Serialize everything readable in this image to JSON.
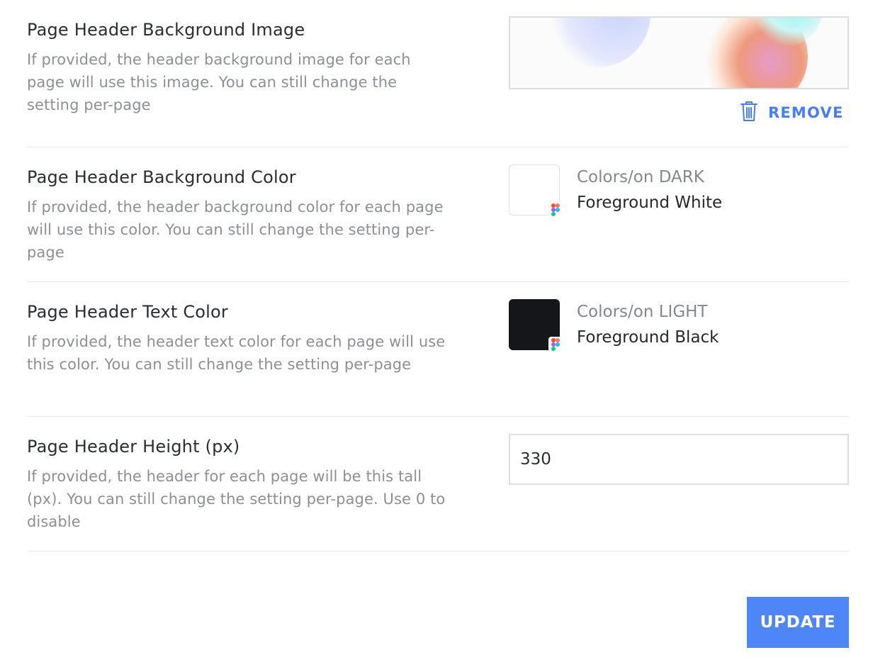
{
  "settings": {
    "background_image": {
      "title": "Page Header Background Image",
      "description": "If provided, the header background image for each page will use this image. You can still change the setting per-page",
      "remove_label": "REMOVE"
    },
    "background_color": {
      "title": "Page Header Background Color",
      "description": "If provided, the header background color for each page will use this color. You can still change the setting per-page",
      "color_group": "Colors/on DARK",
      "color_name": "Foreground White",
      "swatch_color": "#FFFFFF"
    },
    "text_color": {
      "title": "Page Header Text Color",
      "description": "If provided, the header text color for each page will use this color. You can still change the setting per-page",
      "color_group": "Colors/on LIGHT",
      "color_name": "Foreground Black",
      "swatch_color": "#15161A"
    },
    "height": {
      "title": "Page Header Height (px)",
      "description": "If provided, the header for each page will be this tall (px). You can still change the setting per-page. Use 0 to disable",
      "value": "330"
    }
  },
  "actions": {
    "update_label": "UPDATE"
  },
  "icons": {
    "remove": "trash-icon",
    "swatch_badge": "figma-icon"
  },
  "colors": {
    "accent": "#4F86F7",
    "link": "#4A7DF0",
    "title_text": "#2B2D33",
    "muted_text": "#8C8F96",
    "divider": "#E9E9EC"
  }
}
